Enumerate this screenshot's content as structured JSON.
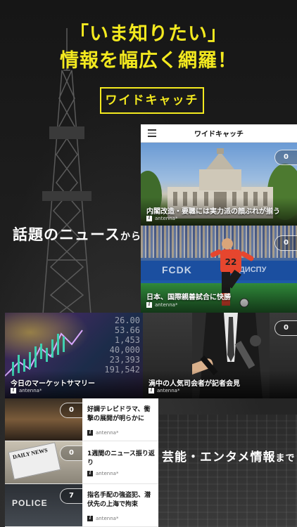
{
  "headline": {
    "line1": "「いま知りたい」",
    "line2": "情報を幅広く網羅！"
  },
  "tag": "ワイドキャッチ",
  "captions": {
    "topics_main": "話題のニュース",
    "topics_suffix": "から",
    "ent_main": "芸能・エンタメ情報",
    "ent_suffix": "まで"
  },
  "phone": {
    "title": "ワイドキャッチ"
  },
  "cards": [
    {
      "title": "内閣改造・要職には実力派の顔ぶれが揃う",
      "source": "antenna*",
      "count": "0"
    },
    {
      "title": "日本、国際親善試合に快勝",
      "source": "antenna*",
      "count": "0"
    },
    {
      "title": "今日のマーケットサマリー",
      "source": "antenna*"
    },
    {
      "title": "渦中の人気司会者が記者会見",
      "source": "antenna*",
      "count": "0"
    }
  ],
  "scene_text": {
    "ad1": "FCDK",
    "ad2": "ДИСПУ",
    "digits": [
      "26.00",
      "53.66",
      "1,453",
      "40,000",
      "23,393",
      "191,542"
    ],
    "newspaper": "DAILY NEWS",
    "police": "POLICE"
  },
  "list": [
    {
      "title": "好調テレビドラマ、衝撃の展開が明らかに",
      "source": "antenna*",
      "count": "0"
    },
    {
      "title": "1週間のニュース振り返り",
      "source": "antenna*",
      "count": "0"
    },
    {
      "title": "指名手配の強盗犯、潜伏先の上海で拘束",
      "source": "antenna*",
      "count": "7"
    }
  ],
  "colors": {
    "accent": "#f3e91f",
    "background": "#141414"
  }
}
